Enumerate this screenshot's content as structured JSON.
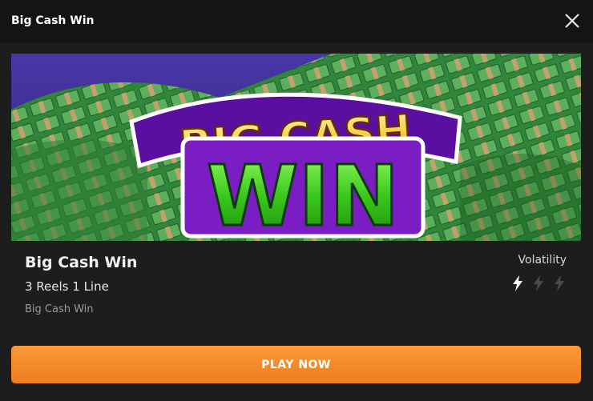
{
  "header": {
    "title": "Big Cash Win",
    "close_icon": "close-icon"
  },
  "banner": {
    "line1": "BIG CASH",
    "line2": "WIN",
    "colors": {
      "gold": "#f3d24a",
      "green": "#39c81b",
      "purple": "#8a1fc9",
      "sky": "#4a36a8"
    }
  },
  "game": {
    "title": "Big Cash Win",
    "subtitle": "3 Reels 1 Line",
    "provider": "Big Cash Win"
  },
  "volatility": {
    "label": "Volatility",
    "level": 1,
    "max": 3,
    "icon": "lightning-icon"
  },
  "play_button": {
    "label": "PLAY NOW",
    "color": "#f5891f"
  }
}
